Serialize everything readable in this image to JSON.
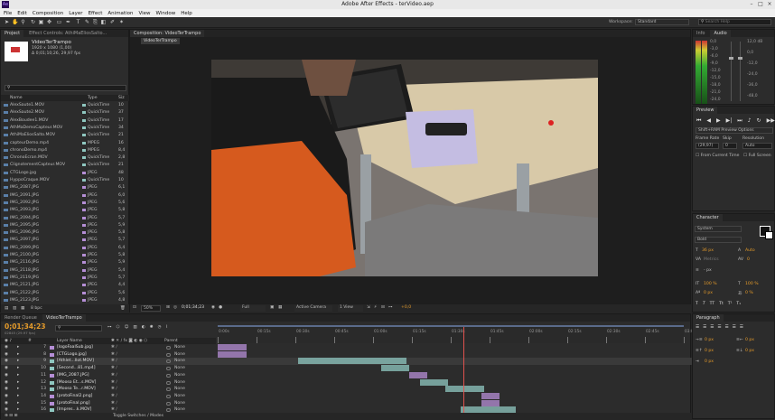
{
  "app": {
    "title": "Adobe After Effects - terVideo.aep",
    "logo": "Ae"
  },
  "menu": [
    "File",
    "Edit",
    "Composition",
    "Layer",
    "Effect",
    "Animation",
    "View",
    "Window",
    "Help"
  ],
  "toolbar": {
    "workspace_label": "Workspace:",
    "workspace_value": "Standard",
    "search_placeholder": "Search Help"
  },
  "project": {
    "tabs": [
      "Project",
      "Effect Controls: AthiMaEliosSalto..."
    ],
    "selected_name": "VideoTerTrampo",
    "selected_dims": "1920 x 1080 (1,00)",
    "selected_dur": "Δ 0;01;10;26, 29,97 fps",
    "columns": {
      "name": "Name",
      "type": "Type",
      "size": "Siz"
    },
    "items": [
      {
        "name": "AlexSaute1.MOV",
        "type": "QuickTime",
        "size": "10"
      },
      {
        "name": "AlexSaute2.MOV",
        "type": "QuickTime",
        "size": "37"
      },
      {
        "name": "AlexBoudee1.MOV",
        "type": "QuickTime",
        "size": "17"
      },
      {
        "name": "AthMaDemoCapteur.MOV",
        "type": "QuickTime",
        "size": "34"
      },
      {
        "name": "AthiMaEliosSalto.MOV",
        "type": "QuickTime",
        "size": "21"
      },
      {
        "name": "capteurDemo.mp4",
        "type": "MPEG",
        "size": "16"
      },
      {
        "name": "chronoDemo.mp4",
        "type": "MPEG",
        "size": "8,4"
      },
      {
        "name": "ChronoEcran.MOV",
        "type": "QuickTime",
        "size": "2,8"
      },
      {
        "name": "ClignotementCapteur.MOV",
        "type": "QuickTime",
        "size": "21"
      },
      {
        "name": "CTGLogo.jpg",
        "type": "JPEG",
        "size": "48"
      },
      {
        "name": "HyppoCraque.MOV",
        "type": "QuickTime",
        "size": "10"
      },
      {
        "name": "IMG_2087.JPG",
        "type": "JPEG",
        "size": "6,1"
      },
      {
        "name": "IMG_2091.JPG",
        "type": "JPEG",
        "size": "6,0"
      },
      {
        "name": "IMG_2092.JPG",
        "type": "JPEG",
        "size": "5,6"
      },
      {
        "name": "IMG_2093.JPG",
        "type": "JPEG",
        "size": "5,8"
      },
      {
        "name": "IMG_2094.JPG",
        "type": "JPEG",
        "size": "5,7"
      },
      {
        "name": "IMG_2095.JPG",
        "type": "JPEG",
        "size": "5,9"
      },
      {
        "name": "IMG_2096.JPG",
        "type": "JPEG",
        "size": "5,8"
      },
      {
        "name": "IMG_2097.JPG",
        "type": "JPEG",
        "size": "5,7"
      },
      {
        "name": "IMG_2099.JPG",
        "type": "JPEG",
        "size": "6,4"
      },
      {
        "name": "IMG_2100.JPG",
        "type": "JPEG",
        "size": "5,8"
      },
      {
        "name": "IMG_2116.JPG",
        "type": "JPEG",
        "size": "5,9"
      },
      {
        "name": "IMG_2118.JPG",
        "type": "JPEG",
        "size": "5,4"
      },
      {
        "name": "IMG_2119.JPG",
        "type": "JPEG",
        "size": "5,7"
      },
      {
        "name": "IMG_2121.JPG",
        "type": "JPEG",
        "size": "4,4"
      },
      {
        "name": "IMG_2122.JPG",
        "type": "JPEG",
        "size": "5,6"
      },
      {
        "name": "IMG_2123.JPG",
        "type": "JPEG",
        "size": "4,8"
      }
    ],
    "footer_bpc": "8 bpc"
  },
  "composition": {
    "tab": "Composition: VideoTerTrampo",
    "subtab": "VideoTerTrampo",
    "zoom": "50%",
    "timecode": "0;01;34;23",
    "resolution": "Full",
    "camera": "Active Camera",
    "view": "1 View",
    "exposure": "+0,0"
  },
  "info": {
    "tabs": [
      "Info",
      "Audio"
    ],
    "db_left": [
      "0,0",
      "-3,0",
      "-6,0",
      "-9,0",
      "-12,0",
      "-15,0",
      "-18,0",
      "-21,0",
      "-24,0"
    ],
    "db_right": [
      "12,0 dB",
      "0,0",
      "-12,0",
      "-24,0",
      "-36,0",
      "-48,0"
    ]
  },
  "preview": {
    "tab": "Preview",
    "option": "Shift+RAM Preview Options",
    "frame_rate_label": "Frame Rate",
    "skip_label": "Skip",
    "resolution_label": "Resolution",
    "frame_rate": "(29,97)",
    "skip": "0",
    "resolution": "Auto",
    "from_current": "From Current Time",
    "full_screen": "Full Screen"
  },
  "character": {
    "tab": "Character",
    "font": "System",
    "style": "Bold",
    "size": "36 px",
    "leading": "Auto",
    "kerning": "Metrics",
    "tracking": "0",
    "stroke": "- px",
    "vscale": "100 %",
    "hscale": "100 %",
    "baseline": "0 px",
    "tsume": "0 %"
  },
  "paragraph": {
    "tab": "Paragraph",
    "values": [
      "0 px",
      "0 px",
      "0 px",
      "0 px",
      "0 px"
    ]
  },
  "timeline": {
    "tabs": [
      "Render Queue",
      "VideoTerTrampo"
    ],
    "timecode": "0;01;34;23",
    "fps": "02845 (29.97 fps)",
    "search_placeholder": "",
    "headers": {
      "layer": "Layer Name",
      "parent": "Parent"
    },
    "ruler": [
      "0:00s",
      "00:15s",
      "00:30s",
      "00:45s",
      "01:00s",
      "01:15s",
      "01:30s",
      "01:45s",
      "02:00s",
      "02:15s",
      "02:30s",
      "02:45s",
      "03:00s"
    ],
    "playhead_seconds": 94.8,
    "duration_seconds": 180,
    "layers": [
      {
        "num": "7",
        "name": "[logoFaalSub.jpg]",
        "mode": "None",
        "color": "#b58ed6",
        "start": 0,
        "end": 11
      },
      {
        "num": "8",
        "name": "[CTGLogo.jpg]",
        "mode": "None",
        "color": "#b58ed6",
        "start": 0,
        "end": 11
      },
      {
        "num": "9",
        "name": "[Athlet...llot.MOV]",
        "mode": "None",
        "color": "#8fc7c0",
        "start": 31,
        "end": 73
      },
      {
        "num": "10",
        "name": "[Second...81.mp4]",
        "mode": "None",
        "color": "#8fc7c0",
        "start": 63,
        "end": 74
      },
      {
        "num": "11",
        "name": "[IMG_2087.JPG]",
        "mode": "None",
        "color": "#b58ed6",
        "start": 74,
        "end": 81
      },
      {
        "num": "12",
        "name": "[Mooso Et...s.MOV]",
        "mode": "None",
        "color": "#8fc7c0",
        "start": 78,
        "end": 89
      },
      {
        "num": "13",
        "name": "[Mooso Te...r.MOV]",
        "mode": "None",
        "color": "#8fc7c0",
        "start": 88,
        "end": 103
      },
      {
        "num": "14",
        "name": "[protoFinal2.png]",
        "mode": "None",
        "color": "#b58ed6",
        "start": 102,
        "end": 109
      },
      {
        "num": "15",
        "name": "[protoFinal.png]",
        "mode": "None",
        "color": "#b58ed6",
        "start": 102,
        "end": 109
      },
      {
        "num": "16",
        "name": "[Impres...k.MOV]",
        "mode": "None",
        "color": "#8fc7c0",
        "start": 94,
        "end": 115
      }
    ],
    "toggle_label": "Toggle Switches / Modes"
  },
  "colors": {
    "accent": "#e59b2a",
    "playhead": "#e0524e",
    "selection": "#3d5f8a"
  }
}
